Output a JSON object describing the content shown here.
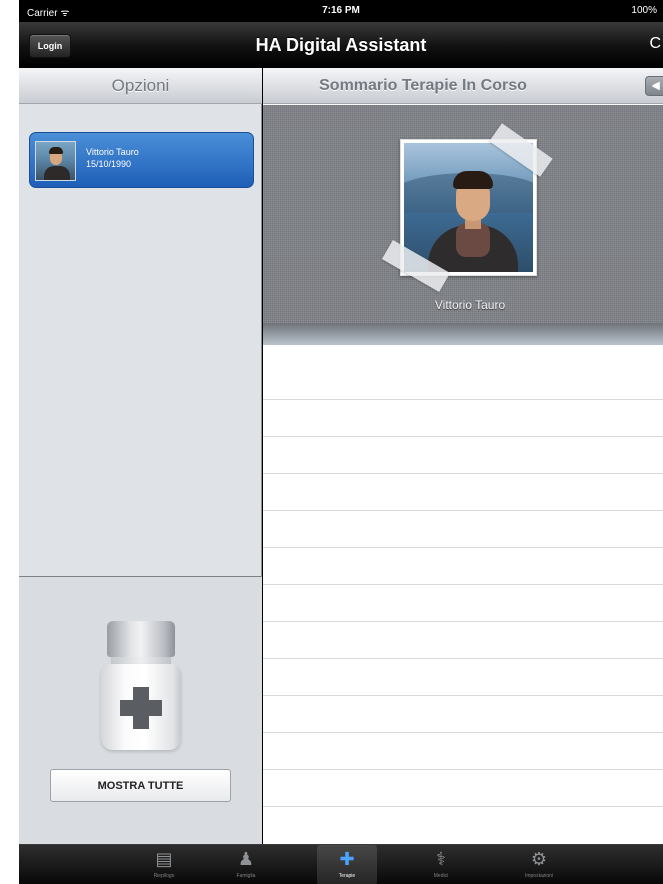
{
  "status": {
    "carrier": "Carrier ᯤ",
    "time": "7:16 PM",
    "battery": "100%"
  },
  "nav": {
    "login_label": "Login",
    "title": "HA Digital Assistant",
    "right_glyph": "C"
  },
  "left": {
    "header": "Opzioni",
    "patient": {
      "name": "Vittorio Tauro",
      "dob": "15/10/1990"
    },
    "show_all_label": "MOSTRA TUTTE"
  },
  "right": {
    "header": "Sommario Terapie In Corso",
    "back_glyph": "◀",
    "profile_name": "Vittorio Tauro"
  },
  "tabs": [
    {
      "label": "Riepilogo",
      "icon": "clipboard-icon",
      "glyph": "▤"
    },
    {
      "label": "Famiglia",
      "icon": "family-icon",
      "glyph": "♟"
    },
    {
      "label": "Terapie",
      "icon": "medical-kit-icon",
      "glyph": "✚"
    },
    {
      "label": "Medici",
      "icon": "doctor-icon",
      "glyph": "⚕"
    },
    {
      "label": "Impostazioni",
      "icon": "gear-icon",
      "glyph": "⚙"
    }
  ],
  "active_tab_index": 2,
  "colors": {
    "selection_blue": "#2f6fc6",
    "active_tab": "#4aa3ff"
  }
}
